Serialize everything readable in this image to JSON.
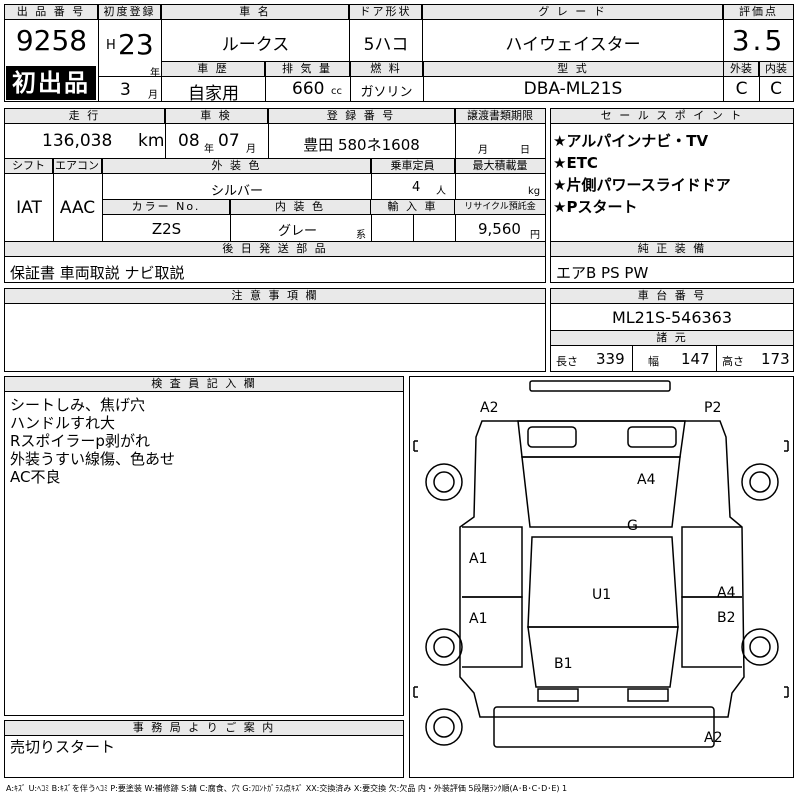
{
  "headers": {
    "lot_no": "出 品 番 号",
    "first_reg": "初度登録",
    "car_name": "車 名",
    "door": "ドア形状",
    "grade": "グ レ ー ド",
    "score": "評価点",
    "history": "車 歴",
    "displacement": "排 気 量",
    "fuel": "燃 料",
    "model_code": "型 式",
    "exterior": "外装",
    "interior": "内装",
    "mileage": "走 行",
    "inspection": "車 検",
    "reg_no": "登 録 番 号",
    "transfer_doc": "譲渡書類期限",
    "sales_points": "セ ー ル ス ポ イ ン ト",
    "shift": "シフト",
    "aircon": "エアコン",
    "ext_color": "外 装 色",
    "capacity": "乗車定員",
    "max_load": "最大積載量",
    "color_no": "カラー No.",
    "int_color": "内 装 色",
    "import": "輸 入 車",
    "recycle": "リサイクル預託金",
    "later_parts": "後 日 発 送 部 品",
    "genuine_equip": "純 正 装 備",
    "caution": "注 意 事 項 欄",
    "chassis_no": "車 台 番 号",
    "dimensions": "諸 元",
    "inspector": "検 査 員 記 入 欄",
    "office": "事 務 局 よ り ご 案 内"
  },
  "lot_number": "9258",
  "first_listing": "初出品",
  "era": "H",
  "year": "23",
  "year_unit": "年",
  "month": "3",
  "month_unit": "月",
  "car_name": "ルークス",
  "door_type": "5ハコ",
  "grade": "ハイウェイスター",
  "score": "3.5",
  "history": "自家用",
  "displacement": "660",
  "displacement_unit": "cc",
  "fuel": "ガソリン",
  "model_code": "DBA-ML21S",
  "exterior_grade": "C",
  "interior_grade": "C",
  "mileage": "136,038",
  "mileage_unit": "km",
  "inspection_year": "08",
  "inspection_year_unit": "年",
  "inspection_month": "07",
  "inspection_month_unit": "月",
  "reg_number": "豊田 580ネ1608",
  "transfer_month_unit": "月",
  "transfer_day_unit": "日",
  "sales_points": [
    "★アルパインナビ・TV",
    "★ETC",
    "★片側パワースライドドア",
    "★Pスタート"
  ],
  "shift": "IAT",
  "aircon": "AAC",
  "ext_color": "シルバー",
  "capacity": "4",
  "capacity_unit": "人",
  "load_unit": "kg",
  "color_code": "Z2S",
  "int_color": "グレー",
  "int_color_suffix": "系",
  "recycle_fee": "9,560",
  "recycle_unit": "円",
  "later_parts": "保証書 車両取説 ナビ取説",
  "genuine_equip": "エアB PS PW",
  "chassis_no": "ML21S-546363",
  "dims": {
    "length_label": "長さ",
    "length": "339",
    "width_label": "幅",
    "width": "147",
    "height_label": "高さ",
    "height": "173"
  },
  "inspector_notes": [
    "シートしみ、焦げ穴",
    "ハンドルすれ大",
    "Rスポイラーp剥がれ",
    "外装うすい線傷、色あせ",
    "AC不良"
  ],
  "office_note": "売切りスタート",
  "diagram_marks": [
    "A2",
    "P2",
    "A4",
    "G",
    "A1",
    "U1",
    "A4",
    "A1",
    "B2",
    "B1",
    "A2"
  ],
  "legend": "A:ｷｽﾞ U:ﾍｺﾐ B:ｷｽﾞを伴うﾍｺﾐ P:要塗装 W:補修跡 S:錆 C:腐食、穴 G:ﾌﾛﾝﾄｶﾞﾗｽ点ｷｽﾞ XX:交換済み X:要交換 欠:欠品 内・外装評価 5段階ﾗﾝｸ順(A･B･C･D･E) 1"
}
